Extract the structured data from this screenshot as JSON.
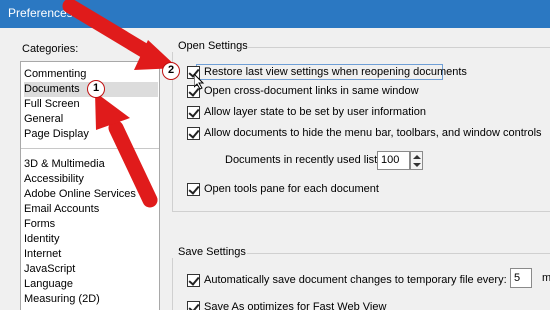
{
  "window": {
    "title": "Preferences"
  },
  "categories": {
    "label": "Categories:",
    "top_items": [
      "Commenting",
      "Documents",
      "Full Screen",
      "General",
      "Page Display"
    ],
    "selected_index": 1,
    "bottom_items": [
      "3D & Multimedia",
      "Accessibility",
      "Adobe Online Services",
      "Email Accounts",
      "Forms",
      "Identity",
      "Internet",
      "JavaScript",
      "Language",
      "Measuring (2D)"
    ]
  },
  "open_settings": {
    "label": "Open Settings",
    "restore_last_view": {
      "label": "Restore last view settings when reopening documents",
      "checked": true
    },
    "cross_document_links": {
      "label": "Open cross-document links in same window",
      "checked": true
    },
    "layer_state": {
      "label": "Allow layer state to be set by user information",
      "checked": true
    },
    "hide_menu_bar": {
      "label": "Allow documents to hide the menu bar, toolbars, and window controls",
      "checked": true
    },
    "recent_docs_label": "Documents in recently used list:",
    "recent_docs_value": "100",
    "tools_pane": {
      "label": "Open tools pane for each document",
      "checked": true
    }
  },
  "save_settings": {
    "label": "Save Settings",
    "auto_save": {
      "label": "Automatically save document changes to temporary file every:",
      "checked": true
    },
    "auto_save_minutes": "5",
    "minutes_unit": "m",
    "fast_web_view": {
      "label": "Save As optimizes for Fast Web View",
      "checked": true
    }
  },
  "annotations": {
    "callout_1": "1",
    "callout_2": "2",
    "arrow_color": "#e01b1b"
  }
}
